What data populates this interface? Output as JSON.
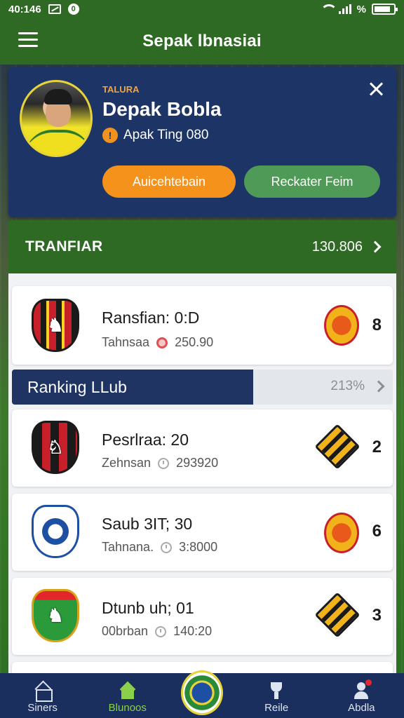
{
  "status_bar": {
    "time": "40:146",
    "notif_count": "0"
  },
  "app_bar": {
    "title": "Sepak lbnasiai"
  },
  "profile": {
    "eyebrow": "TALURA",
    "name": "Depak Bobla",
    "meta_badge": "!",
    "meta_text": "Apak Ting  080",
    "primary_button": "Auicehtebain",
    "secondary_button": "Reckater Feim"
  },
  "transfer": {
    "title": "TRANFIAR",
    "value": "130.806"
  },
  "ranking": {
    "title": "Ranking LLub",
    "percent": "213%"
  },
  "matches": [
    {
      "title": "Ransfian: 0:D",
      "sub_label": "Tahnsaa",
      "sub_value": "250.90",
      "score": "8"
    },
    {
      "title": "Pesrlraa: 20",
      "sub_label": "Zehnsan",
      "sub_value": "293920",
      "score": "2"
    },
    {
      "title": "Saub 3IT; 30",
      "sub_label": "Tahnana.",
      "sub_value": "3:8000",
      "score": "6"
    },
    {
      "title": "Dtunb uh; 01",
      "sub_label": "00brban",
      "sub_value": "140:20",
      "score": "3"
    }
  ],
  "bottom_nav": [
    {
      "label": "Siners",
      "icon": "home-icon"
    },
    {
      "label": "Blunoos",
      "icon": "house-filled-icon"
    },
    {
      "label": "",
      "icon": "club-emblem"
    },
    {
      "label": "Reile",
      "icon": "trophy-icon"
    },
    {
      "label": "Abdla",
      "icon": "user-icon"
    }
  ],
  "colors": {
    "app_bar": "#2f6a25",
    "profile_card": "#1d3566",
    "primary_button": "#f4921c",
    "secondary_button": "#4f9a56",
    "ranking_tab": "#1f3462",
    "bottom_nav": "#1b2f5e",
    "nav_active": "#8bd04a"
  }
}
